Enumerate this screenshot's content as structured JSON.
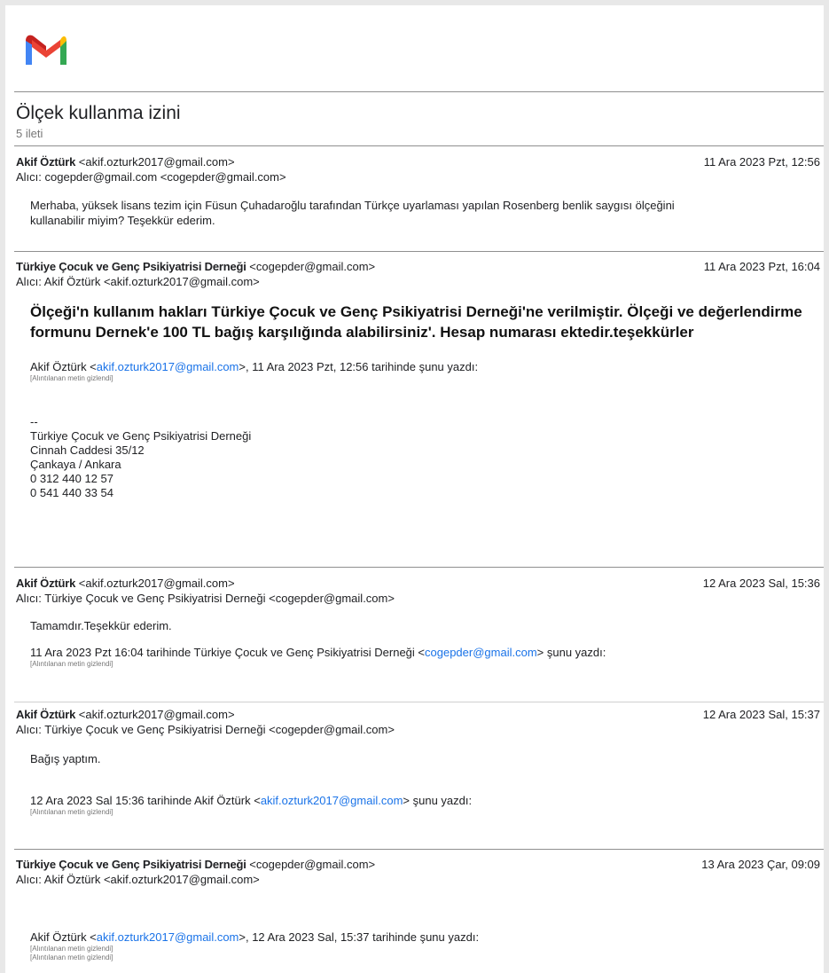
{
  "thread": {
    "subject": "Ölçek kullanma izini",
    "count_label": "5 ileti"
  },
  "messages": [
    {
      "from_name": "Akif Öztürk",
      "from_email": "<akif.ozturk2017@gmail.com>",
      "date": "11 Ara 2023 Pzt, 12:56",
      "to": "Alıcı: cogepder@gmail.com <cogepder@gmail.com>",
      "body_line1": "Merhaba, yüksek lisans tezim için Füsun Çuhadaroğlu tarafından Türkçe uyarlaması yapılan Rosenberg benlik saygısı ölçeğini",
      "body_line2": "kullanabilir miyim? Teşekkür ederim."
    },
    {
      "from_name": "Türkiye Çocuk ve Genç Psikiyatrisi Derneği",
      "from_email": "<cogepder@gmail.com>",
      "date": "11 Ara 2023 Pzt, 16:04",
      "to": "Alıcı: Akif Öztürk <akif.ozturk2017@gmail.com>",
      "big_line1": "Ölçeği'n kullanım hakları Türkiye Çocuk ve Genç Psikiyatrisi Derneği'ne verilmiştir. Ölçeği ve değerlendirme",
      "big_line2": "formunu Dernek'e 100 TL bağış karşılığında alabilirsiniz'. Hesap numarası ektedir.teşekkürler",
      "quote_prefix": "Akif Öztürk <",
      "quote_link": "akif.ozturk2017@gmail.com",
      "quote_suffix": ">, 11 Ara 2023 Pzt, 12:56 tarihinde şunu yazdı:",
      "hidden_quote": "[Alıntılanan metin gizlendi]",
      "sig_dash": "--",
      "sig_lines": [
        "Türkiye Çocuk ve Genç Psikiyatrisi Derneği",
        "Cinnah Caddesi 35/12",
        "Çankaya / Ankara",
        "0 312 440 12 57",
        "0 541 440 33 54"
      ]
    },
    {
      "from_name": "Akif Öztürk",
      "from_email": "<akif.ozturk2017@gmail.com>",
      "date": "12 Ara 2023 Sal, 15:36",
      "to": "Alıcı: Türkiye Çocuk ve Genç Psikiyatrisi Derneği <cogepder@gmail.com>",
      "body": "Tamamdır.Teşekkür ederim.",
      "quote_prefix": "11 Ara 2023 Pzt 16:04 tarihinde Türkiye Çocuk ve Genç Psikiyatrisi Derneği <",
      "quote_link": "cogepder@gmail.com",
      "quote_suffix": "> şunu yazdı:",
      "hidden_quote": "[Alıntılanan metin gizlendi]"
    },
    {
      "from_name": "Akif Öztürk",
      "from_email": "<akif.ozturk2017@gmail.com>",
      "date": "12 Ara 2023 Sal, 15:37",
      "to": "Alıcı: Türkiye Çocuk ve Genç Psikiyatrisi Derneği <cogepder@gmail.com>",
      "body": "Bağış yaptım.",
      "quote_prefix": "12 Ara 2023 Sal 15:36 tarihinde Akif Öztürk <",
      "quote_link": "akif.ozturk2017@gmail.com",
      "quote_suffix": "> şunu yazdı:",
      "hidden_quote": "[Alıntılanan metin gizlendi]"
    },
    {
      "from_name": "Türkiye Çocuk ve Genç Psikiyatrisi Derneği",
      "from_email": "<cogepder@gmail.com>",
      "date": "13 Ara 2023 Çar, 09:09",
      "to": "Alıcı: Akif Öztürk <akif.ozturk2017@gmail.com>",
      "quote_prefix": "Akif Öztürk <",
      "quote_link": "akif.ozturk2017@gmail.com",
      "quote_suffix": ">, 12 Ara 2023 Sal, 15:37 tarihinde şunu yazdı:",
      "hidden_quote_1": "[Alıntılanan metin gizlendi]",
      "hidden_quote_2": "[Alıntılanan metin gizlendi]"
    }
  ],
  "colors": {
    "link": "#1a73e8",
    "gmail_red": "#ea4335",
    "gmail_blue": "#4285f4",
    "gmail_green": "#34a853",
    "gmail_yellow": "#fbbc04",
    "gmail_darkred": "#c5221f"
  }
}
